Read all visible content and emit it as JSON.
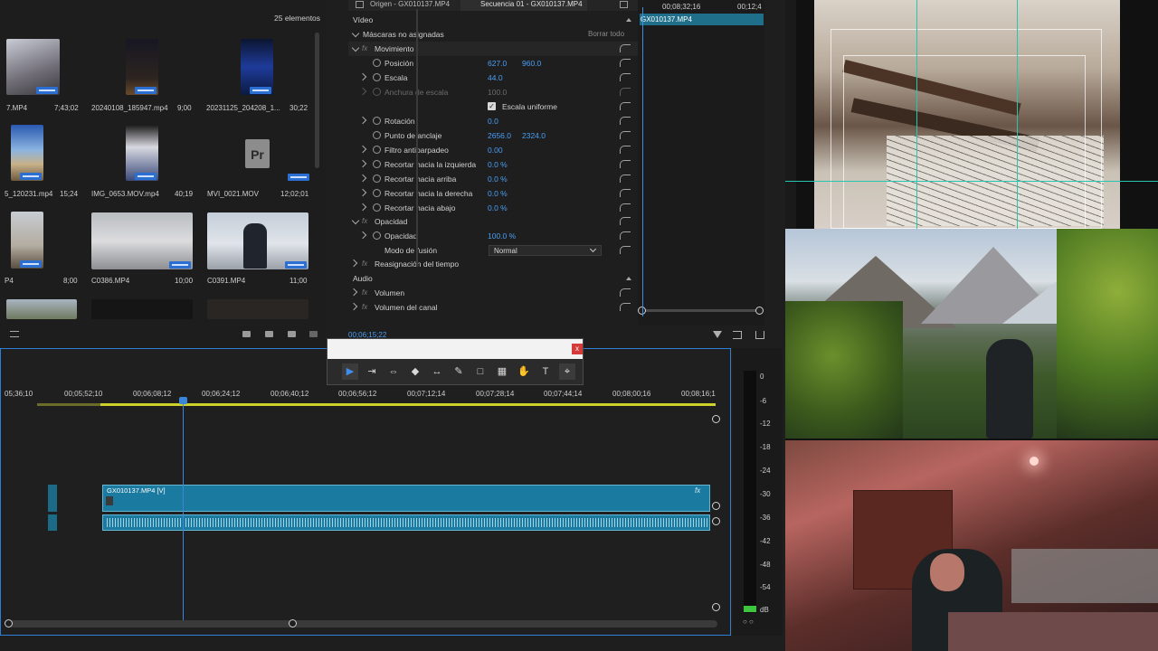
{
  "project": {
    "count": "25 elementos",
    "items": [
      {
        "name": "7.MP4",
        "dur": "7;43;02"
      },
      {
        "name": "20240108_185947.mp4",
        "dur": "9;00"
      },
      {
        "name": "20231125_204208_1...",
        "dur": "30;22"
      },
      {
        "name": "5_120231.mp4",
        "dur": "15;24"
      },
      {
        "name": "IMG_0653.MOV.mp4",
        "dur": "40;19"
      },
      {
        "name": "MVI_0021.MOV",
        "dur": "12;02;01"
      },
      {
        "name": "P4",
        "dur": "8;00"
      },
      {
        "name": "C0386.MP4",
        "dur": "10;00"
      },
      {
        "name": "C0391.MP4",
        "dur": "11;00"
      }
    ]
  },
  "fx_panel": {
    "tab_source": "Origen - GX010137.MP4",
    "tab_sequence": "Secuencia 01 - GX010137.MP4",
    "time_a": "00;08;32;16",
    "time_b": "00;12;4",
    "clip_name": "GX010137.MP4",
    "video_header": "Vídeo",
    "masks": "Máscaras no asignadas",
    "clear_all": "Borrar todo",
    "movement": "Movimiento",
    "position": "Posición",
    "position_x": "627.0",
    "position_y": "960.0",
    "scale": "Escala",
    "scale_val": "44.0",
    "scale_width": "Anchura de escala",
    "scale_width_val": "100.0",
    "uniform": "Escala uniforme",
    "rotation": "Rotación",
    "rotation_val": "0.0",
    "anchor": "Punto de anclaje",
    "anchor_x": "2656.0",
    "anchor_y": "2324.0",
    "antiflicker": "Filtro antiparpadeo",
    "antiflicker_val": "0.00",
    "crop_left": "Recortar hacia la izquierda",
    "crop_top": "Recortar hacia arriba",
    "crop_right": "Recortar hacia la derecha",
    "crop_bottom": "Recortar hacia abajo",
    "crop_val": "0.0 %",
    "opacity_group": "Opacidad",
    "opacity": "Opacidad",
    "opacity_val": "100.0 %",
    "blend": "Modo de fusión",
    "blend_val": "Normal",
    "time_remap": "Reasignación del tiempo",
    "audio_header": "Audio",
    "volume": "Volumen",
    "channel_volume": "Volumen del canal",
    "timecode": "00;06;15;22"
  },
  "tools": {
    "close": "x",
    "items": [
      "selection",
      "track-select",
      "ripple",
      "razor",
      "slip",
      "pen",
      "rectangle",
      "hand-move",
      "hand",
      "type",
      "remix"
    ]
  },
  "timeline": {
    "ticks": [
      "05;36;10",
      "00;05;52;10",
      "00;06;08;12",
      "00;06;24;12",
      "00;06;40;12",
      "00;06;56;12",
      "00;07;12;14",
      "00;07;28;14",
      "00;07;44;14",
      "00;08;00;16",
      "00;08;16;1"
    ],
    "video_clip": "GX010137.MP4 [V]",
    "fx_badge": "fx"
  },
  "meter": {
    "labels": [
      "0",
      "-6",
      "-12",
      "-18",
      "-24",
      "-30",
      "-36",
      "-42",
      "-48",
      "-54",
      "dB"
    ],
    "footer": "○ ○"
  },
  "colors": {
    "accent": "#2f7ed8",
    "clip": "#1a7aa0",
    "value_blue": "#4a9ff5"
  }
}
